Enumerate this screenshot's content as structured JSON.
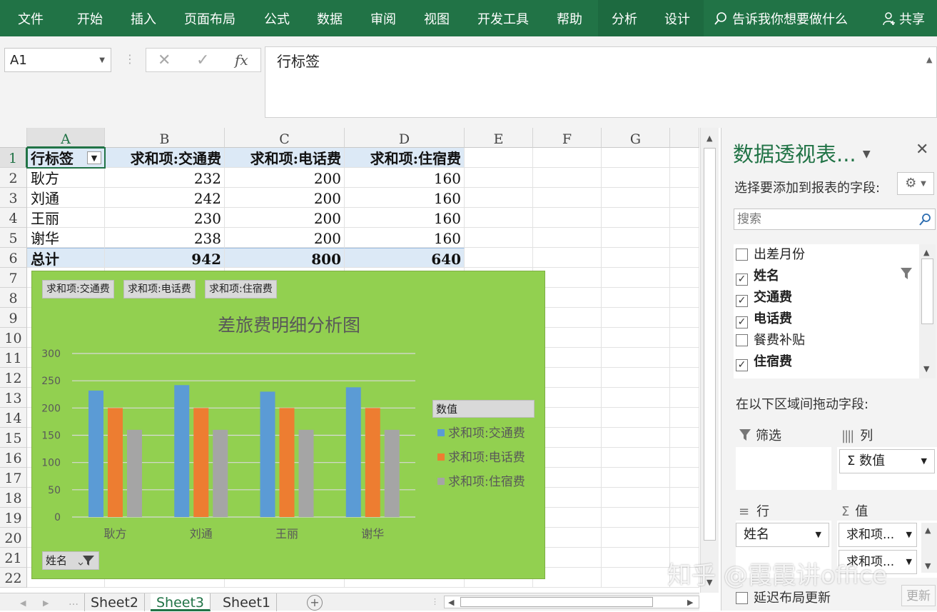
{
  "ribbon": {
    "tabs": [
      "文件",
      "开始",
      "插入",
      "页面布局",
      "公式",
      "数据",
      "审阅",
      "视图",
      "开发工具",
      "帮助",
      "分析",
      "设计"
    ],
    "tell_me": "告诉我你想要做什么",
    "share": "共享"
  },
  "formula_bar": {
    "name_box": "A1",
    "fx": "fx",
    "content": "行标签"
  },
  "grid": {
    "columns": [
      "A",
      "B",
      "C",
      "D",
      "E",
      "F",
      "G"
    ],
    "rows": [
      "1",
      "2",
      "3",
      "4",
      "5",
      "6",
      "7",
      "8",
      "9",
      "10",
      "11",
      "12",
      "13",
      "14",
      "15",
      "16",
      "17",
      "18",
      "19",
      "20",
      "21",
      "22"
    ],
    "pivot": {
      "headers": [
        "行标签",
        "求和项:交通费",
        "求和项:电话费",
        "求和项:住宿费"
      ],
      "data": [
        [
          "耿方",
          "232",
          "200",
          "160"
        ],
        [
          "刘通",
          "242",
          "200",
          "160"
        ],
        [
          "王丽",
          "230",
          "200",
          "160"
        ],
        [
          "谢华",
          "238",
          "200",
          "160"
        ]
      ],
      "total": [
        "总计",
        "942",
        "800",
        "640"
      ]
    }
  },
  "chart": {
    "field_buttons": [
      "求和项:交通费",
      "求和项:电话费",
      "求和项:住宿费"
    ],
    "legend_header": "数值",
    "axis_field": "姓名"
  },
  "chart_data": {
    "type": "bar",
    "title": "差旅费明细分析图",
    "categories": [
      "耿方",
      "刘通",
      "王丽",
      "谢华"
    ],
    "series": [
      {
        "name": "求和项:交通费",
        "color": "#5b9bd5",
        "values": [
          232,
          242,
          230,
          238
        ]
      },
      {
        "name": "求和项:电话费",
        "color": "#ed7d31",
        "values": [
          200,
          200,
          200,
          200
        ]
      },
      {
        "name": "求和项:住宿费",
        "color": "#a5a5a5",
        "values": [
          160,
          160,
          160,
          160
        ]
      }
    ],
    "ylim": [
      0,
      300
    ],
    "yticks": [
      "0",
      "50",
      "100",
      "150",
      "200",
      "250",
      "300"
    ],
    "grid": true,
    "legend": "right"
  },
  "sheets": {
    "tabs": [
      "Sheet2",
      "Sheet3",
      "Sheet1"
    ],
    "active": "Sheet3"
  },
  "pivot_pane": {
    "title": "数据透视表...",
    "subtitle": "选择要添加到报表的字段:",
    "search_placeholder": "搜索",
    "fields": [
      {
        "label": "出差月份",
        "checked": false
      },
      {
        "label": "姓名",
        "checked": true
      },
      {
        "label": "交通费",
        "checked": true
      },
      {
        "label": "电话费",
        "checked": true
      },
      {
        "label": "餐费补贴",
        "checked": false
      },
      {
        "label": "住宿费",
        "checked": true
      }
    ],
    "drag_label": "在以下区域间拖动字段:",
    "areas": {
      "filter": "筛选",
      "columns": "列",
      "rows": "行",
      "values": "值"
    },
    "column_item": "Σ 数值",
    "row_item": "姓名",
    "value_items": [
      "求和项...",
      "求和项..."
    ],
    "defer": "延迟布局更新",
    "update": "更新"
  },
  "watermark": "知乎 @霞霞讲office"
}
